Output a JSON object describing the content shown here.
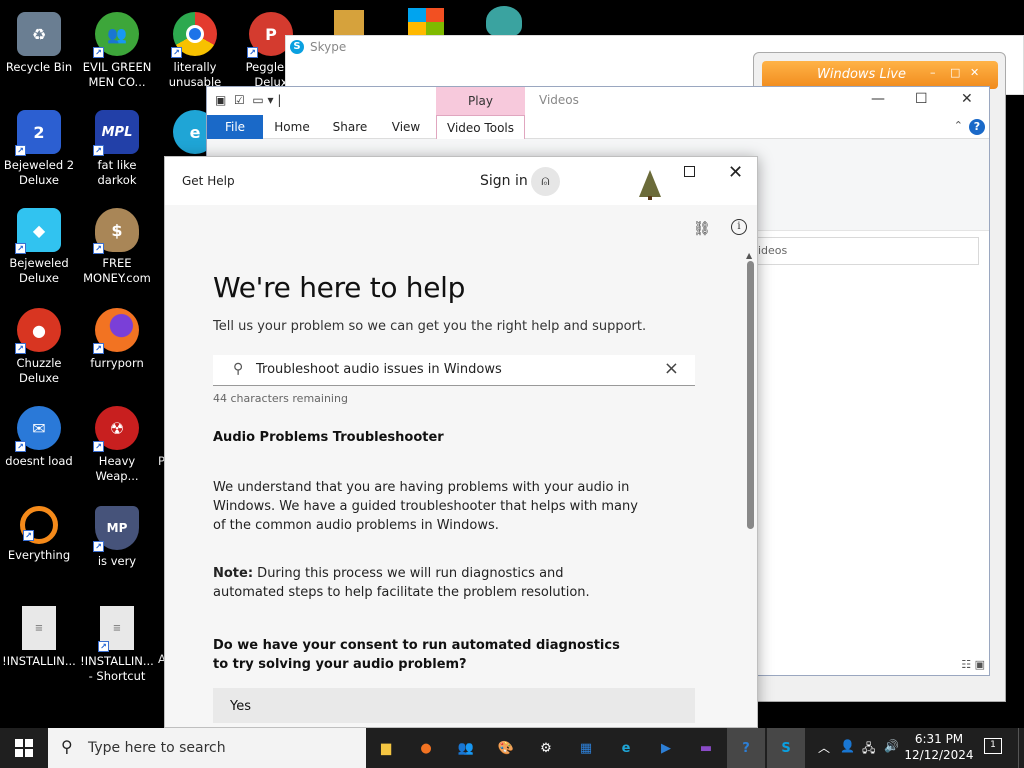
{
  "desktop": {
    "icons": [
      {
        "label": "Recycle Bin",
        "icon": "recycle-bin-icon",
        "color": "#6a7e92"
      },
      {
        "label": "EVIL GREEN MEN CO...",
        "icon": "messenger-people-icon",
        "color": "#3da63a"
      },
      {
        "label": "literally unusable",
        "icon": "chrome-icon",
        "color": "#1d73e8"
      },
      {
        "label": "Peggle N Delux",
        "icon": "peggle-icon",
        "color": "#d43b2f"
      },
      {
        "label": "Bejeweled 2 Deluxe",
        "icon": "bejeweled-2-icon",
        "color": "#2c5fd1"
      },
      {
        "label": "fat like darkok",
        "icon": "mpl-icon",
        "color": "#2240a8"
      },
      {
        "label": "Bejeweled Deluxe",
        "icon": "gem-icon",
        "color": "#31c3f0"
      },
      {
        "label": "FREE MONEY.com",
        "icon": "money-bag-icon",
        "color": "#a98657"
      },
      {
        "label": "Chuzzle Deluxe",
        "icon": "chuzzle-icon",
        "color": "#d83521"
      },
      {
        "label": "furryporn",
        "icon": "firefox-icon",
        "color": "#f27322"
      },
      {
        "label": "doesnt load",
        "icon": "thunderbird-icon",
        "color": "#2a79d8"
      },
      {
        "label": "Heavy Weap...",
        "icon": "radiation-icon",
        "color": "#c81f1f"
      },
      {
        "label": "Everything",
        "icon": "search-ring-icon",
        "color": "#f58a1a"
      },
      {
        "label": "is very",
        "icon": "mp-shield-icon",
        "color": "#46537a"
      },
      {
        "label": "!INSTALLIN...",
        "icon": "text-file-icon",
        "color": "#e8e8e8"
      },
      {
        "label": "!INSTALLIN... - Shortcut",
        "icon": "text-file-icon",
        "color": "#e8e8e8"
      }
    ],
    "partial_labels": [
      "P",
      "A"
    ]
  },
  "skype": {
    "title": "Skype",
    "icon_letter": "S"
  },
  "windows_live": {
    "title": "Windows Live",
    "controls": [
      "–",
      "□",
      "✕"
    ]
  },
  "explorer": {
    "title": "Videos",
    "context_tab": "Play",
    "tabs": [
      "File",
      "Home",
      "Share",
      "View",
      "Video Tools"
    ],
    "address_text": "ideos",
    "help_glyph": "?",
    "controls": [
      "—",
      "☐",
      "✕"
    ]
  },
  "gethelp": {
    "app_title": "Get Help",
    "sign_in": "Sign in",
    "heading": "We're here to help",
    "subheading": "Tell us your problem so we can get you the right help and support.",
    "search_value": "Troubleshoot audio issues in Windows",
    "chars_remaining": "44 characters remaining",
    "result_title": "Audio Problems Troubleshooter",
    "paragraph1": "We understand that you are having problems with your audio in Windows. We have a guided troubleshooter that helps with many of the common audio problems in Windows.",
    "note_label": "Note:",
    "note_text": " During this process we will run diagnostics and automated steps to help facilitate the problem resolution.",
    "question": "Do we have your consent to run automated diagnostics to try solving your audio problem?",
    "yes_label": "Yes"
  },
  "taskbar": {
    "search_placeholder": "Type here to search",
    "time": "6:31 PM",
    "date": "12/12/2024",
    "notification_count": "1",
    "apps": [
      {
        "name": "file-explorer-icon",
        "color": "#f4c542",
        "glyph": "▆"
      },
      {
        "name": "firefox-icon",
        "color": "#f27322",
        "glyph": "●"
      },
      {
        "name": "messenger-icon",
        "color": "#3da63a",
        "glyph": "👥"
      },
      {
        "name": "paint-icon",
        "color": "#e0e0e0",
        "glyph": "🎨"
      },
      {
        "name": "settings-icon",
        "color": "#ffffff",
        "glyph": "⚙"
      },
      {
        "name": "calendar-icon",
        "color": "#2d7fd6",
        "glyph": "▦"
      },
      {
        "name": "edge-icon",
        "color": "#1fa5d6",
        "glyph": "e"
      },
      {
        "name": "media-player-icon",
        "color": "#2d7fd6",
        "glyph": "▶"
      },
      {
        "name": "video-editor-icon",
        "color": "#8a4bc7",
        "glyph": "▬"
      },
      {
        "name": "get-help-icon",
        "color": "#2d7fd6",
        "glyph": "?"
      },
      {
        "name": "skype-icon",
        "color": "#0aa0e0",
        "glyph": "S"
      }
    ]
  }
}
